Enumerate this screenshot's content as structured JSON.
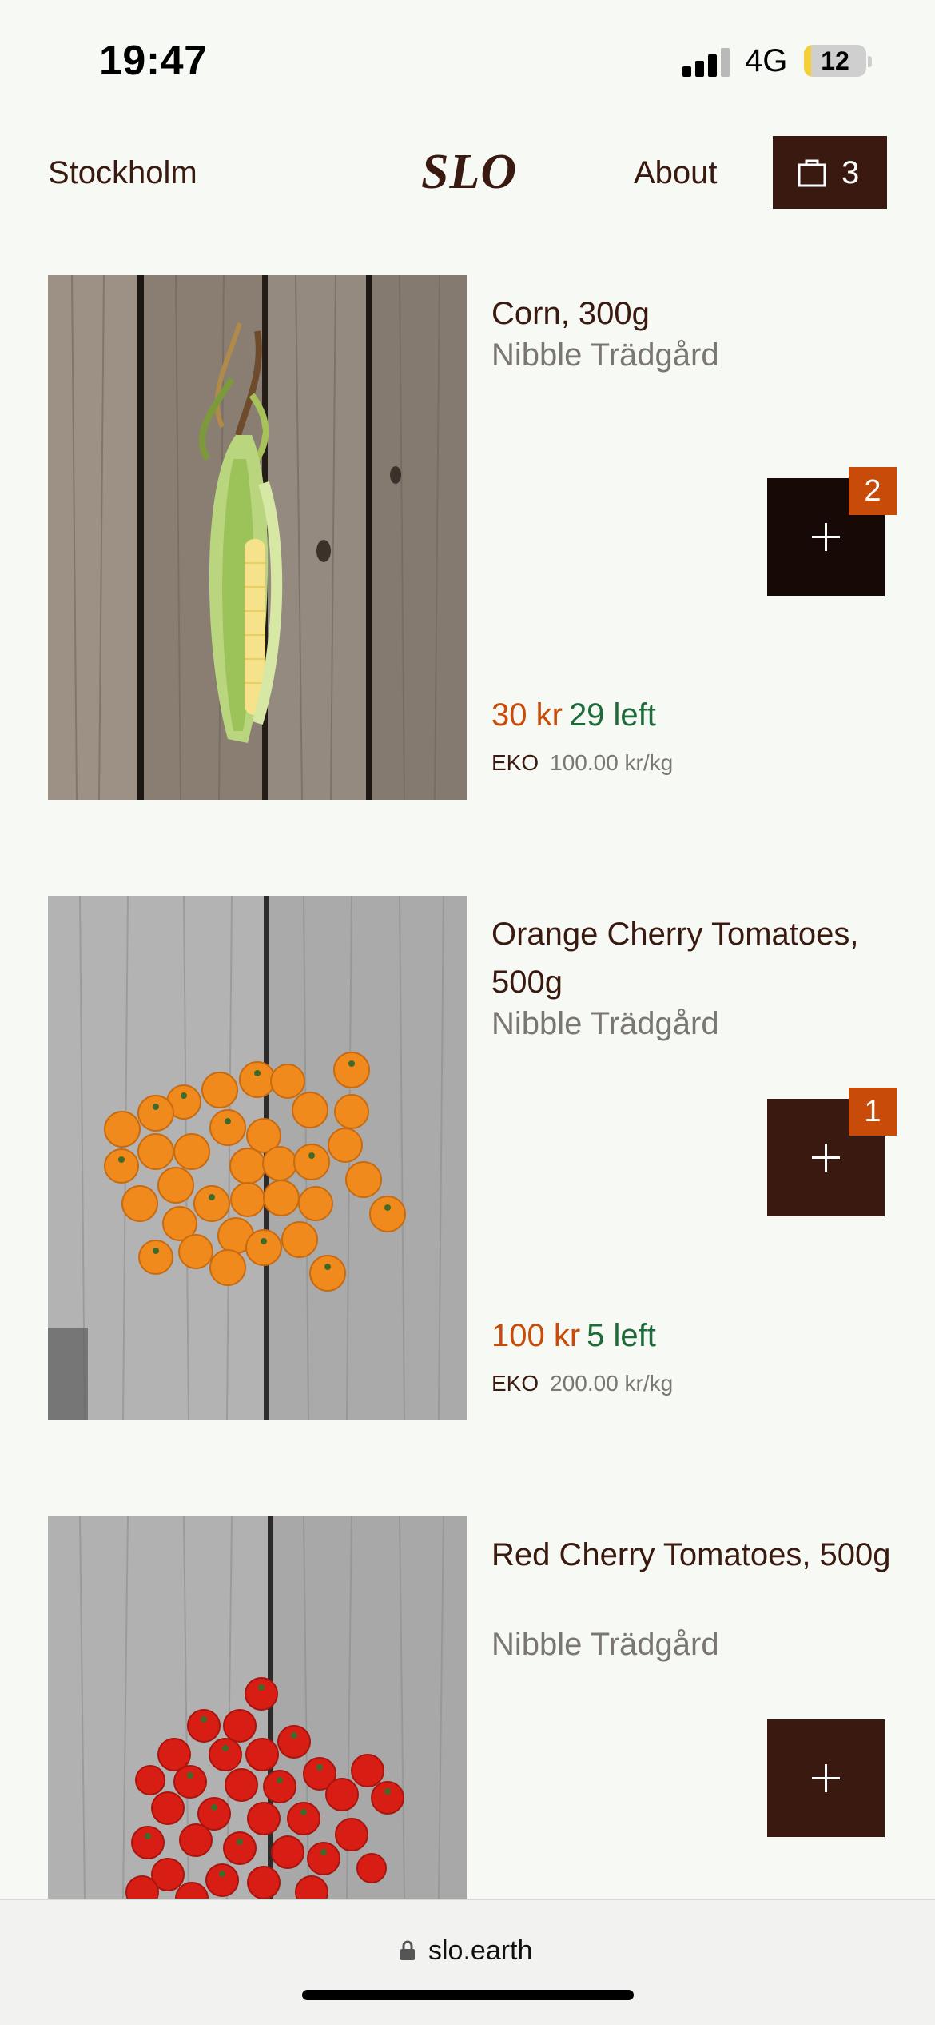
{
  "status_bar": {
    "time": "19:47",
    "network": "4G",
    "battery": "12",
    "battery_level_percent": 12
  },
  "header": {
    "city": "Stockholm",
    "logo": "SLO",
    "about": "About",
    "cart_icon": "shopping-bag-icon",
    "cart_count": "3"
  },
  "products": [
    {
      "title": "Corn, 300g",
      "farm": "Nibble Trädgård",
      "price": "30 kr",
      "stock": "29 left",
      "label": "EKO",
      "unit_price": "100.00 kr/kg",
      "in_cart": "2",
      "add_icon": "plus-icon"
    },
    {
      "title": "Orange Cherry Tomatoes, 500g",
      "farm": "Nibble Trädgård",
      "price": "100 kr",
      "stock": "5 left",
      "label": "EKO",
      "unit_price": "200.00 kr/kg",
      "in_cart": "1",
      "add_icon": "plus-icon"
    },
    {
      "title": "Red Cherry Tomatoes, 500g",
      "farm": "Nibble Trädgård",
      "add_icon": "plus-icon"
    }
  ],
  "browser": {
    "url": "slo.earth",
    "lock_icon": "lock-icon"
  },
  "colors": {
    "background": "#f7faf4",
    "brand_dark": "#3a1a10",
    "price_orange": "#c84b0a",
    "stock_green": "#1e6a3a",
    "muted_text": "#7a7671"
  }
}
